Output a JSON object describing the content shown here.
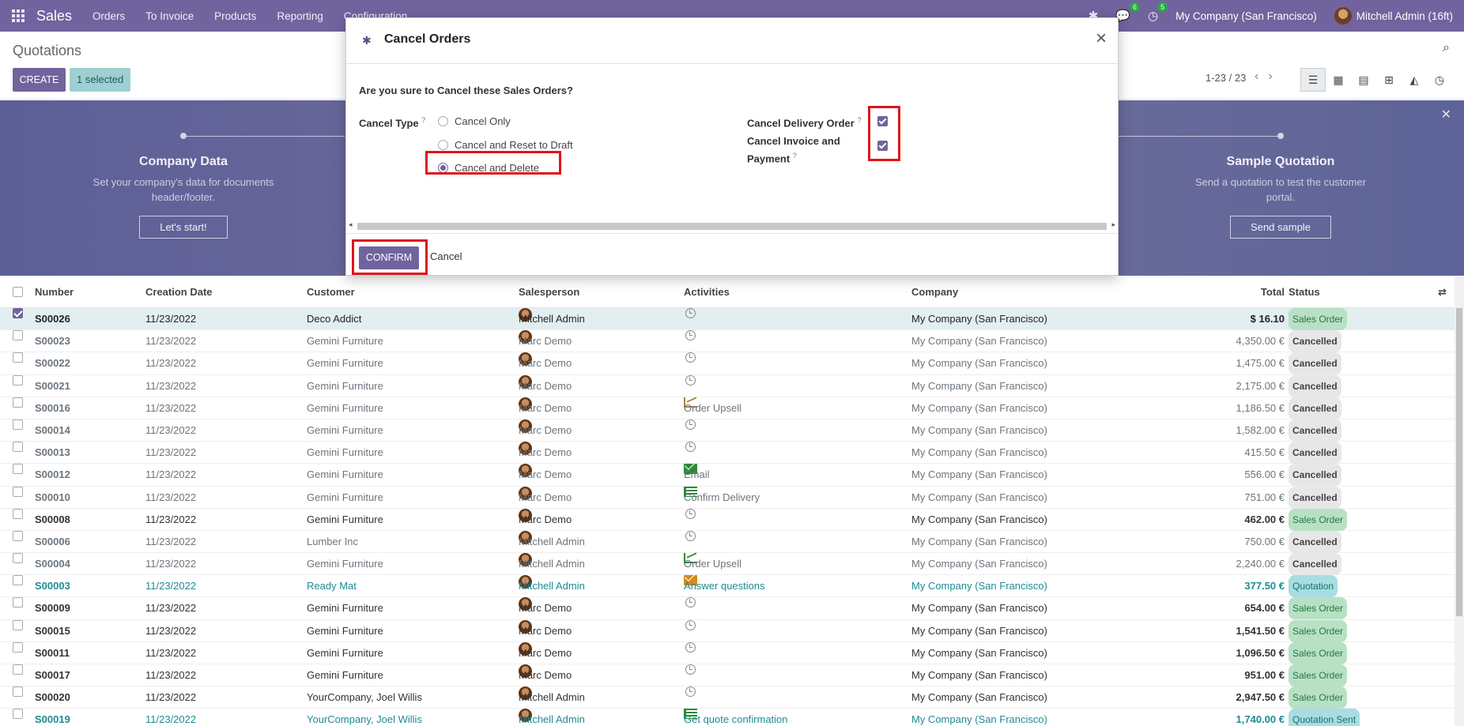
{
  "navbar": {
    "brand": "Sales",
    "menus": [
      "Orders",
      "To Invoice",
      "Products",
      "Reporting",
      "Configuration"
    ],
    "chat_count": "6",
    "activity_count": "5",
    "company": "My Company (San Francisco)",
    "user": "Mitchell Admin (16ft)"
  },
  "control_panel": {
    "title": "Quotations",
    "create_label": "CREATE",
    "selected_label": "1 selected",
    "pager": "1-23 / 23"
  },
  "banner": {
    "left": {
      "title": "Company Data",
      "text1": "Set your company's data for documents",
      "text2": "header/footer.",
      "button": "Let's start!"
    },
    "right": {
      "title": "Sample Quotation",
      "text1": "Send a quotation to test the customer",
      "text2": "portal.",
      "button": "Send sample"
    }
  },
  "table": {
    "headers": {
      "number": "Number",
      "date": "Creation Date",
      "customer": "Customer",
      "salesperson": "Salesperson",
      "activities": "Activities",
      "company": "Company",
      "total": "Total",
      "status": "Status"
    },
    "rows": [
      {
        "number": "S00026",
        "date": "11/23/2022",
        "customer": "Deco Addict",
        "salesperson": "Mitchell Admin",
        "activity": "",
        "company": "My Company (San Francisco)",
        "total": "$ 16.10",
        "status": "Sales Order"
      },
      {
        "number": "S00023",
        "date": "11/23/2022",
        "customer": "Gemini Furniture",
        "salesperson": "Marc Demo",
        "activity": "",
        "company": "My Company (San Francisco)",
        "total": "4,350.00 €",
        "status": "Cancelled"
      },
      {
        "number": "S00022",
        "date": "11/23/2022",
        "customer": "Gemini Furniture",
        "salesperson": "Marc Demo",
        "activity": "",
        "company": "My Company (San Francisco)",
        "total": "1,475.00 €",
        "status": "Cancelled"
      },
      {
        "number": "S00021",
        "date": "11/23/2022",
        "customer": "Gemini Furniture",
        "salesperson": "Marc Demo",
        "activity": "",
        "company": "My Company (San Francisco)",
        "total": "2,175.00 €",
        "status": "Cancelled"
      },
      {
        "number": "S00016",
        "date": "11/23/2022",
        "customer": "Gemini Furniture",
        "salesperson": "Marc Demo",
        "activity": "Order Upsell",
        "company": "My Company (San Francisco)",
        "total": "1,186.50 €",
        "status": "Cancelled"
      },
      {
        "number": "S00014",
        "date": "11/23/2022",
        "customer": "Gemini Furniture",
        "salesperson": "Marc Demo",
        "activity": "",
        "company": "My Company (San Francisco)",
        "total": "1,582.00 €",
        "status": "Cancelled"
      },
      {
        "number": "S00013",
        "date": "11/23/2022",
        "customer": "Gemini Furniture",
        "salesperson": "Marc Demo",
        "activity": "",
        "company": "My Company (San Francisco)",
        "total": "415.50 €",
        "status": "Cancelled"
      },
      {
        "number": "S00012",
        "date": "11/23/2022",
        "customer": "Gemini Furniture",
        "salesperson": "Marc Demo",
        "activity": "Email",
        "company": "My Company (San Francisco)",
        "total": "556.00 €",
        "status": "Cancelled"
      },
      {
        "number": "S00010",
        "date": "11/23/2022",
        "customer": "Gemini Furniture",
        "salesperson": "Marc Demo",
        "activity": "Confirm Delivery",
        "company": "My Company (San Francisco)",
        "total": "751.00 €",
        "status": "Cancelled"
      },
      {
        "number": "S00008",
        "date": "11/23/2022",
        "customer": "Gemini Furniture",
        "salesperson": "Marc Demo",
        "activity": "",
        "company": "My Company (San Francisco)",
        "total": "462.00 €",
        "status": "Sales Order"
      },
      {
        "number": "S00006",
        "date": "11/23/2022",
        "customer": "Lumber Inc",
        "salesperson": "Mitchell Admin",
        "activity": "",
        "company": "My Company (San Francisco)",
        "total": "750.00 €",
        "status": "Cancelled"
      },
      {
        "number": "S00004",
        "date": "11/23/2022",
        "customer": "Gemini Furniture",
        "salesperson": "Mitchell Admin",
        "activity": "Order Upsell",
        "company": "My Company (San Francisco)",
        "total": "2,240.00 €",
        "status": "Cancelled"
      },
      {
        "number": "S00003",
        "date": "11/23/2022",
        "customer": "Ready Mat",
        "salesperson": "Mitchell Admin",
        "activity": "Answer questions",
        "company": "My Company (San Francisco)",
        "total": "377.50 €",
        "status": "Quotation"
      },
      {
        "number": "S00009",
        "date": "11/23/2022",
        "customer": "Gemini Furniture",
        "salesperson": "Marc Demo",
        "activity": "",
        "company": "My Company (San Francisco)",
        "total": "654.00 €",
        "status": "Sales Order"
      },
      {
        "number": "S00015",
        "date": "11/23/2022",
        "customer": "Gemini Furniture",
        "salesperson": "Marc Demo",
        "activity": "",
        "company": "My Company (San Francisco)",
        "total": "1,541.50 €",
        "status": "Sales Order"
      },
      {
        "number": "S00011",
        "date": "11/23/2022",
        "customer": "Gemini Furniture",
        "salesperson": "Marc Demo",
        "activity": "",
        "company": "My Company (San Francisco)",
        "total": "1,096.50 €",
        "status": "Sales Order"
      },
      {
        "number": "S00017",
        "date": "11/23/2022",
        "customer": "Gemini Furniture",
        "salesperson": "Marc Demo",
        "activity": "",
        "company": "My Company (San Francisco)",
        "total": "951.00 €",
        "status": "Sales Order"
      },
      {
        "number": "S00020",
        "date": "11/23/2022",
        "customer": "YourCompany, Joel Willis",
        "salesperson": "Mitchell Admin",
        "activity": "",
        "company": "My Company (San Francisco)",
        "total": "2,947.50 €",
        "status": "Sales Order"
      },
      {
        "number": "S00019",
        "date": "11/23/2022",
        "customer": "YourCompany, Joel Willis",
        "salesperson": "Mitchell Admin",
        "activity": "Get quote confirmation",
        "company": "My Company (San Francisco)",
        "total": "1,740.00 €",
        "status": "Quotation Sent"
      }
    ]
  },
  "modal": {
    "title": "Cancel Orders",
    "question": "Are you sure to Cancel these Sales Orders?",
    "cancel_type_label": "Cancel Type",
    "help_mark": "?",
    "options": [
      "Cancel Only",
      "Cancel and Reset to Draft",
      "Cancel and Delete"
    ],
    "selected_option": "Cancel and Delete",
    "cancel_delivery_label": "Cancel Delivery Order",
    "cancel_delivery_checked": true,
    "cancel_invoice_label_1": "Cancel Invoice and",
    "cancel_invoice_label_2": "Payment",
    "cancel_invoice_checked": true,
    "confirm_label": "CONFIRM",
    "cancel_label": "Cancel"
  },
  "colors": {
    "brand": "#71639e",
    "highlight": "#e0131a"
  }
}
